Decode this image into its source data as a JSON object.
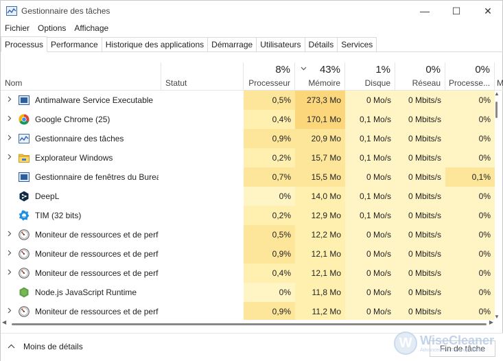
{
  "window": {
    "title": "Gestionnaire des tâches",
    "minimize": "—",
    "maximize": "☐",
    "close": "✕"
  },
  "menu": [
    "Fichier",
    "Options",
    "Affichage"
  ],
  "tabs": [
    {
      "label": "Processus",
      "active": true
    },
    {
      "label": "Performance"
    },
    {
      "label": "Historique des applications"
    },
    {
      "label": "Démarrage"
    },
    {
      "label": "Utilisateurs"
    },
    {
      "label": "Détails"
    },
    {
      "label": "Services"
    }
  ],
  "columns": {
    "name": "Nom",
    "status": "Statut",
    "cpu": {
      "pct": "8%",
      "label": "Processeur"
    },
    "memory": {
      "pct": "43%",
      "label": "Mémoire"
    },
    "disk": {
      "pct": "1%",
      "label": "Disque"
    },
    "network": {
      "pct": "0%",
      "label": "Réseau"
    },
    "gpu": {
      "pct": "0%",
      "label": "Processe..."
    },
    "more": "M"
  },
  "processes": [
    {
      "name": "Antimalware Service Executable",
      "icon": "shield-app-icon",
      "expandable": true,
      "cpu": "0,5%",
      "mem": "273,3 Mo",
      "disk": "0 Mo/s",
      "net": "0 Mbits/s",
      "gpu": "0%"
    },
    {
      "name": "Google Chrome (25)",
      "icon": "chrome-icon",
      "expandable": true,
      "cpu": "0,4%",
      "mem": "170,1 Mo",
      "disk": "0,1 Mo/s",
      "net": "0 Mbits/s",
      "gpu": "0%"
    },
    {
      "name": "Gestionnaire des tâches",
      "icon": "task-manager-icon",
      "expandable": true,
      "cpu": "0,9%",
      "mem": "20,9 Mo",
      "disk": "0,1 Mo/s",
      "net": "0 Mbits/s",
      "gpu": "0%"
    },
    {
      "name": "Explorateur Windows",
      "icon": "folder-icon",
      "expandable": true,
      "cpu": "0,2%",
      "mem": "15,7 Mo",
      "disk": "0,1 Mo/s",
      "net": "0 Mbits/s",
      "gpu": "0%"
    },
    {
      "name": "Gestionnaire de fenêtres du Bureau",
      "icon": "window-app-icon",
      "expandable": false,
      "cpu": "0,7%",
      "mem": "15,5 Mo",
      "disk": "0 Mo/s",
      "net": "0 Mbits/s",
      "gpu": "0,1%"
    },
    {
      "name": "DeepL",
      "icon": "deepl-icon",
      "expandable": false,
      "cpu": "0%",
      "mem": "14,0 Mo",
      "disk": "0,1 Mo/s",
      "net": "0 Mbits/s",
      "gpu": "0%"
    },
    {
      "name": "TIM (32 bits)",
      "icon": "tim-icon",
      "expandable": false,
      "cpu": "0,2%",
      "mem": "12,9 Mo",
      "disk": "0,1 Mo/s",
      "net": "0 Mbits/s",
      "gpu": "0%"
    },
    {
      "name": "Moniteur de ressources et de performances",
      "icon": "monitor-icon",
      "expandable": true,
      "cpu": "0,5%",
      "mem": "12,2 Mo",
      "disk": "0 Mo/s",
      "net": "0 Mbits/s",
      "gpu": "0%"
    },
    {
      "name": "Moniteur de ressources et de performances",
      "icon": "monitor-icon",
      "expandable": true,
      "cpu": "0,9%",
      "mem": "12,1 Mo",
      "disk": "0 Mo/s",
      "net": "0 Mbits/s",
      "gpu": "0%"
    },
    {
      "name": "Moniteur de ressources et de performances",
      "icon": "monitor-icon",
      "expandable": true,
      "cpu": "0,4%",
      "mem": "12,1 Mo",
      "disk": "0 Mo/s",
      "net": "0 Mbits/s",
      "gpu": "0%"
    },
    {
      "name": "Node.js JavaScript Runtime",
      "icon": "nodejs-icon",
      "expandable": false,
      "cpu": "0%",
      "mem": "11,8 Mo",
      "disk": "0 Mo/s",
      "net": "0 Mbits/s",
      "gpu": "0%"
    },
    {
      "name": "Moniteur de ressources et de performances",
      "icon": "monitor-icon",
      "expandable": true,
      "cpu": "0,9%",
      "mem": "11,2 Mo",
      "disk": "0 Mo/s",
      "net": "0 Mbits/s",
      "gpu": "0%"
    }
  ],
  "footer": {
    "less_details": "Moins de détails",
    "end_task": "Fin de tâche"
  },
  "watermark": {
    "logo": "W",
    "title": "WiseCleaner",
    "subtitle": "Advanced PC Tune-up Utilities"
  },
  "colors": {
    "heat_low": "#fff4c4",
    "heat_mid": "#fff0b0",
    "heat_high": "#fde69a",
    "heat_max": "#fbd67a"
  }
}
